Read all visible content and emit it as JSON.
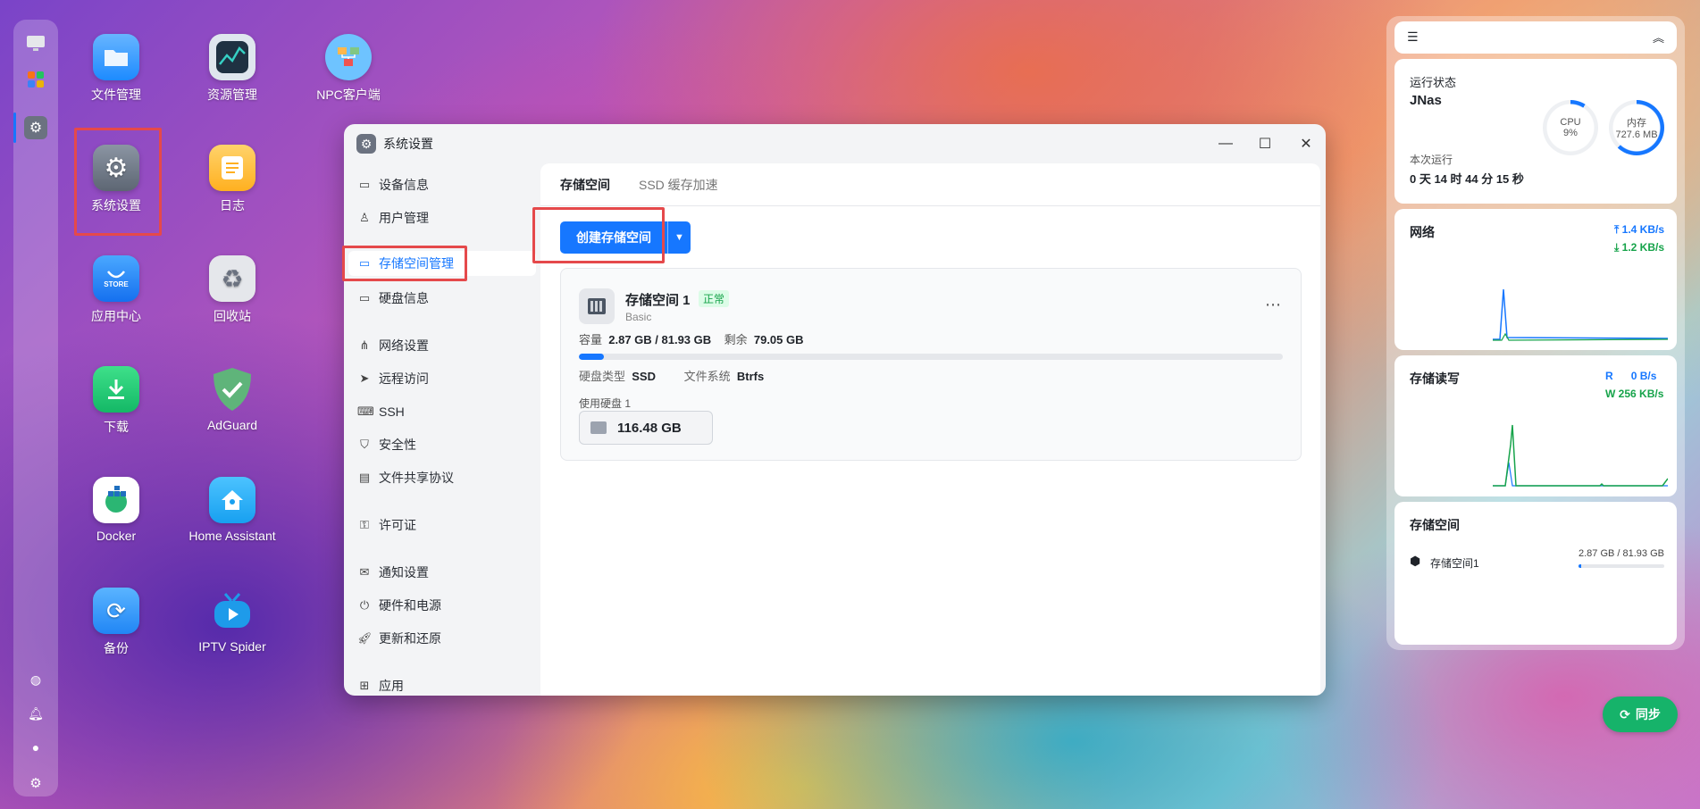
{
  "desktop": {
    "icons": [
      {
        "label": "文件管理"
      },
      {
        "label": "资源管理"
      },
      {
        "label": "NPC客户端"
      },
      {
        "label": "系统设置"
      },
      {
        "label": "日志"
      },
      {
        "label": "应用中心"
      },
      {
        "label": "回收站"
      },
      {
        "label": "下载"
      },
      {
        "label": "AdGuard"
      },
      {
        "label": "Docker"
      },
      {
        "label": "Home Assistant"
      },
      {
        "label": "备份"
      },
      {
        "label": "IPTV Spider"
      }
    ],
    "store_text": "STORE"
  },
  "window": {
    "title": "系统设置",
    "sidebar": [
      {
        "label": "设备信息",
        "icon": "device-icon"
      },
      {
        "label": "用户管理",
        "icon": "user-icon"
      },
      {
        "label": "存储空间管理",
        "icon": "storage-icon",
        "active": true
      },
      {
        "label": "硬盘信息",
        "icon": "disk-icon"
      },
      {
        "label": "网络设置",
        "icon": "network-icon"
      },
      {
        "label": "远程访问",
        "icon": "send-icon"
      },
      {
        "label": "SSH",
        "icon": "terminal-icon"
      },
      {
        "label": "安全性",
        "icon": "shield-icon"
      },
      {
        "label": "文件共享协议",
        "icon": "file-icon"
      },
      {
        "label": "许可证",
        "icon": "key-icon"
      },
      {
        "label": "通知设置",
        "icon": "mail-icon"
      },
      {
        "label": "硬件和电源",
        "icon": "power-icon"
      },
      {
        "label": "更新和还原",
        "icon": "rocket-icon"
      },
      {
        "label": "应用",
        "icon": "apps-icon"
      }
    ],
    "tabs": [
      {
        "label": "存储空间",
        "active": true
      },
      {
        "label": "SSD 缓存加速",
        "active": false
      }
    ],
    "create_button": "创建存储空间",
    "pool": {
      "name": "存储空间 1",
      "status": "正常",
      "type": "Basic",
      "capacity_label": "容量",
      "capacity_value": "2.87 GB / 81.93 GB",
      "free_label": "剩余",
      "free_value": "79.05 GB",
      "usage_fraction": 0.035,
      "disk_type_label": "硬盘类型",
      "disk_type_value": "SSD",
      "fs_label": "文件系统",
      "fs_value": "Btrfs",
      "used_disks_label": "使用硬盘 1",
      "disk_size": "116.48 GB"
    }
  },
  "panel": {
    "status": {
      "title": "运行状态",
      "host": "JNas",
      "uptime_label": "本次运行",
      "uptime_value": "0 天 14 时 44 分 15 秒",
      "cpu_label": "CPU",
      "cpu_value": "9%",
      "cpu_fraction": 0.09,
      "mem_label": "内存",
      "mem_value": "727.6 MB",
      "mem_fraction": 0.62
    },
    "network": {
      "title": "网络",
      "up": "1.4 KB/s",
      "down": "1.2 KB/s"
    },
    "disk_io": {
      "title": "存储读写",
      "read_label": "R",
      "read_value": "0 B/s",
      "write_label": "W",
      "write_value": "256 KB/s"
    },
    "storage": {
      "title": "存储空间",
      "item_name": "存储空间1",
      "item_value": "2.87 GB / 81.93 GB",
      "fraction": 0.035
    }
  },
  "sync_button": "同步",
  "colors": {
    "accent": "#1677ff",
    "success": "#16b36a",
    "highlight": "#e5494b"
  }
}
